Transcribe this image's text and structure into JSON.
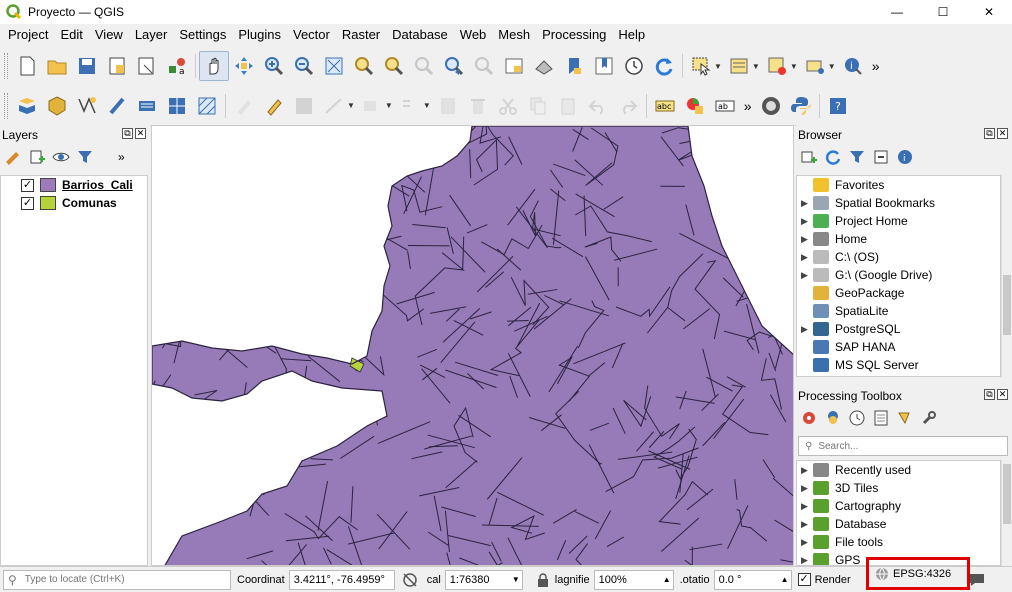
{
  "window": {
    "title": "Proyecto — QGIS",
    "minimize": "—",
    "maximize": "☐",
    "close": "✕"
  },
  "menu": [
    "Project",
    "Edit",
    "View",
    "Layer",
    "Settings",
    "Plugins",
    "Vector",
    "Raster",
    "Database",
    "Web",
    "Mesh",
    "Processing",
    "Help"
  ],
  "layers_panel": {
    "title": "Layers",
    "more": "»",
    "layers": [
      {
        "name": "Barrios_Cali",
        "checked": "✓",
        "color": "#9b7cb9"
      },
      {
        "name": "Comunas",
        "checked": "✓",
        "color": "#b5d33a"
      }
    ]
  },
  "browser_panel": {
    "title": "Browser",
    "items": [
      {
        "label": "Favorites",
        "icon": "star-icon",
        "color": "#f2c12e"
      },
      {
        "label": "Spatial Bookmarks",
        "icon": "bookmark-icon",
        "color": "#9aa6b4"
      },
      {
        "label": "Project Home",
        "icon": "project-home-icon",
        "color": "#4caf50"
      },
      {
        "label": "Home",
        "icon": "home-icon",
        "color": "#888888"
      },
      {
        "label": "C:\\ (OS)",
        "icon": "drive-icon",
        "color": "#bbbbbb"
      },
      {
        "label": "G:\\ (Google Drive)",
        "icon": "drive-icon",
        "color": "#bbbbbb"
      },
      {
        "label": "GeoPackage",
        "icon": "geopackage-icon",
        "color": "#e2b23a"
      },
      {
        "label": "SpatiaLite",
        "icon": "spatialite-icon",
        "color": "#6f8fb7"
      },
      {
        "label": "PostgreSQL",
        "icon": "postgresql-icon",
        "color": "#336791"
      },
      {
        "label": "SAP HANA",
        "icon": "sap-hana-icon",
        "color": "#4a78b5"
      },
      {
        "label": "MS SQL Server",
        "icon": "mssql-icon",
        "color": "#3a6fb0"
      }
    ]
  },
  "toolbox_panel": {
    "title": "Processing Toolbox",
    "search_placeholder": "Search...",
    "items": [
      {
        "label": "Recently used",
        "icon": "clock-icon",
        "color": "#888888"
      },
      {
        "label": "3D Tiles",
        "icon": "qgis-icon",
        "color": "#5aa02c"
      },
      {
        "label": "Cartography",
        "icon": "qgis-icon",
        "color": "#5aa02c"
      },
      {
        "label": "Database",
        "icon": "qgis-icon",
        "color": "#5aa02c"
      },
      {
        "label": "File tools",
        "icon": "qgis-icon",
        "color": "#5aa02c"
      },
      {
        "label": "GPS",
        "icon": "qgis-icon",
        "color": "#5aa02c"
      }
    ]
  },
  "statusbar": {
    "locate_placeholder": "Type to locate (Ctrl+K)",
    "coordinate_label": "Coordinat",
    "coordinate_value": "3.4211°, -76.4959°",
    "scale_label": "cal",
    "scale_value": "1:76380",
    "magnifier_label": "lagnifie",
    "magnifier_value": "100%",
    "rotation_label": ".otatio",
    "rotation_value": "0.0 °",
    "render_label": "Render",
    "render_checked": "✓",
    "crs": "EPSG:4326"
  },
  "colors": {
    "polygon_fill": "#977bb8",
    "polygon_stroke": "#2b2340",
    "highlight": "#e00000"
  }
}
